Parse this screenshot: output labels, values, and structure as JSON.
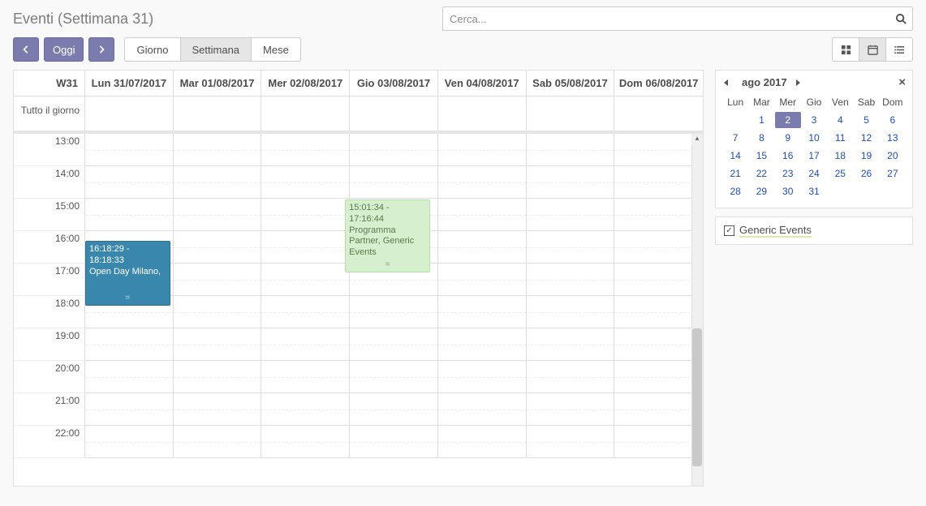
{
  "page_title": "Eventi (Settimana 31)",
  "search": {
    "placeholder": "Cerca..."
  },
  "nav": {
    "today": "Oggi"
  },
  "range_modes": {
    "day": "Giorno",
    "week": "Settimana",
    "month": "Mese",
    "active": "week"
  },
  "view_modes": {
    "active": "calendar"
  },
  "calendar": {
    "week_label": "W31",
    "days": [
      "Lun 31/07/2017",
      "Mar 01/08/2017",
      "Mer 02/08/2017",
      "Gio 03/08/2017",
      "Ven 04/08/2017",
      "Sab 05/08/2017",
      "Dom 06/08/2017"
    ],
    "allday_label": "Tutto il giorno",
    "hours": [
      "13:00",
      "14:00",
      "15:00",
      "16:00",
      "17:00",
      "18:00",
      "19:00",
      "20:00",
      "21:00",
      "22:00"
    ],
    "first_hour": 13,
    "events": [
      {
        "day_index": 0,
        "time_label": "16:18:29 - 18:18:33",
        "title": "Open Day Milano,",
        "start_hour": 16.3,
        "end_hour": 18.3,
        "color": "blue"
      },
      {
        "day_index": 3,
        "time_label": "15:01:34 - 17:16:44",
        "title": "Programma Partner, Generic Events",
        "start_hour": 15.03,
        "end_hour": 17.28,
        "color": "green"
      }
    ]
  },
  "mini_calendar": {
    "title": "ago 2017",
    "dow": [
      "Lun",
      "Mar",
      "Mer",
      "Gio",
      "Ven",
      "Sab",
      "Dom"
    ],
    "leading_blanks": 1,
    "days": 31,
    "today": 2
  },
  "filters": {
    "generic_events": {
      "label": "Generic Events",
      "checked": true
    }
  }
}
